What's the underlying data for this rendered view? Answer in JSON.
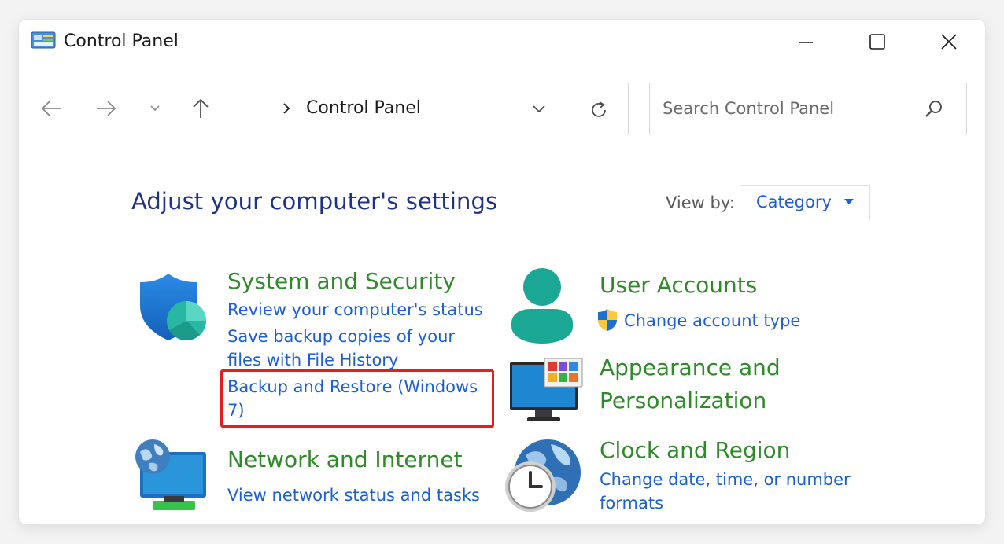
{
  "window": {
    "title": "Control Panel"
  },
  "titlebar": {
    "icon": "control-panel-icon",
    "buttons": [
      {
        "name": "minimize",
        "icon": "minimize-icon"
      },
      {
        "name": "maximize",
        "icon": "maximize-icon"
      },
      {
        "name": "close",
        "icon": "close-icon"
      }
    ]
  },
  "nav": {
    "back_icon": "arrow-left-icon",
    "forward_icon": "arrow-right-icon",
    "recent_icon": "chevron-down-icon",
    "up_icon": "arrow-up-icon"
  },
  "address": {
    "separator_icon": "chevron-right-icon",
    "path": "Control Panel",
    "dropdown_icon": "chevron-down-icon",
    "refresh_icon": "refresh-icon"
  },
  "search": {
    "placeholder": "Search Control Panel",
    "value": "",
    "icon": "search-icon"
  },
  "main": {
    "heading": "Adjust your computer's settings",
    "view_by": {
      "label": "View by:",
      "value": "Category"
    },
    "categories": [
      {
        "title": "System and Security",
        "icon": "shield-icon",
        "links": [
          "Review your computer's status",
          "Save backup copies of your files with File History",
          "Backup and Restore (Windows 7)"
        ]
      },
      {
        "title": "Network and Internet",
        "icon": "network-globe-icon",
        "links": [
          "View network status and tasks"
        ]
      },
      {
        "title": "User Accounts",
        "icon": "user-icon",
        "links": [
          "Change account type"
        ],
        "link_icon": "uac-shield-icon"
      },
      {
        "title": "Appearance and Personalization",
        "icon": "monitor-icon",
        "links": []
      },
      {
        "title": "Clock and Region",
        "icon": "clock-globe-icon",
        "links": [
          "Change date, time, or number formats"
        ]
      }
    ]
  },
  "colors": {
    "category_title": "#2f8a2a",
    "link": "#1b5fd0",
    "heading": "#1e3287",
    "highlight": "#e0201c"
  }
}
